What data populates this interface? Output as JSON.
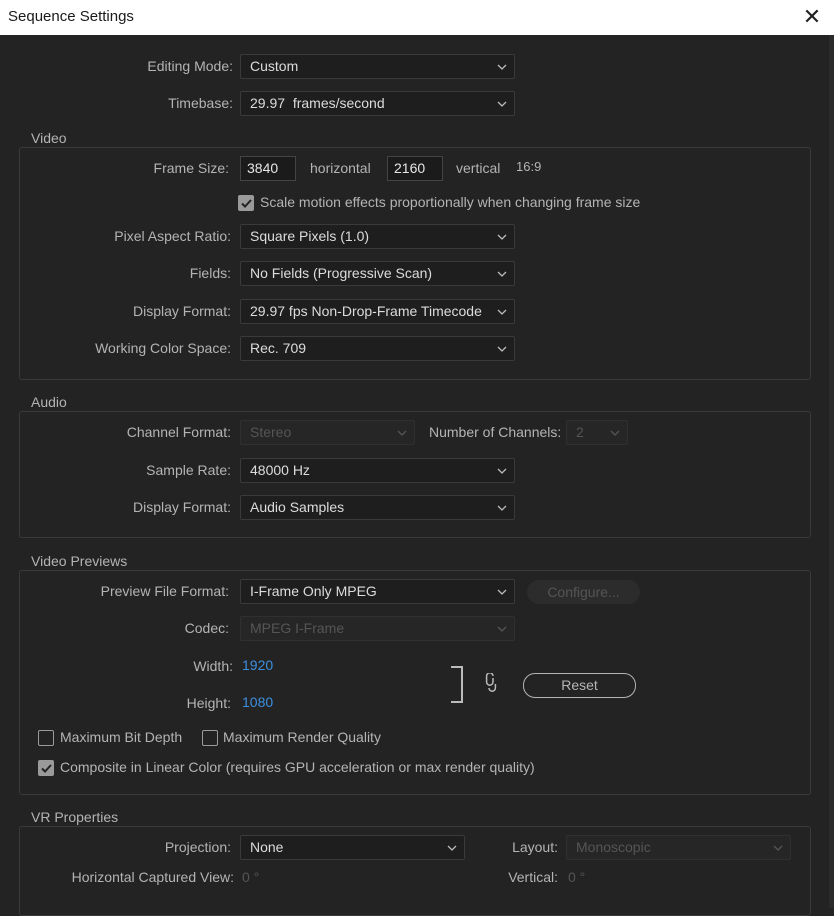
{
  "window": {
    "title": "Sequence Settings",
    "close_glyph": "✕"
  },
  "general": {
    "editing_mode_label": "Editing Mode:",
    "editing_mode_value": "Custom",
    "timebase_label": "Timebase:",
    "timebase_value": "29.97  frames/second"
  },
  "video": {
    "group_title": "Video",
    "frame_size_label": "Frame Size:",
    "frame_width": "3840",
    "horizontal_label": "horizontal",
    "frame_height": "2160",
    "vertical_label": "vertical",
    "aspect": "16:9",
    "scale_motion_label": "Scale motion effects proportionally when changing frame size",
    "scale_motion_checked": true,
    "pixel_aspect_label": "Pixel Aspect Ratio:",
    "pixel_aspect_value": "Square Pixels (1.0)",
    "fields_label": "Fields:",
    "fields_value": "No Fields (Progressive Scan)",
    "display_format_label": "Display Format:",
    "display_format_value": "29.97 fps Non-Drop-Frame Timecode",
    "color_space_label": "Working Color Space:",
    "color_space_value": "Rec. 709"
  },
  "audio": {
    "group_title": "Audio",
    "channel_format_label": "Channel Format:",
    "channel_format_value": "Stereo",
    "num_channels_label": "Number of Channels:",
    "num_channels_value": "2",
    "sample_rate_label": "Sample Rate:",
    "sample_rate_value": "48000 Hz",
    "display_format_label": "Display Format:",
    "display_format_value": "Audio Samples"
  },
  "previews": {
    "group_title": "Video Previews",
    "file_format_label": "Preview File Format:",
    "file_format_value": "I-Frame Only MPEG",
    "configure_label": "Configure...",
    "codec_label": "Codec:",
    "codec_value": "MPEG I-Frame",
    "width_label": "Width:",
    "width_value": "1920",
    "height_label": "Height:",
    "height_value": "1080",
    "reset_label": "Reset",
    "max_bit_depth_label": "Maximum Bit Depth",
    "max_bit_depth_checked": false,
    "max_render_quality_label": "Maximum Render Quality",
    "max_render_quality_checked": false,
    "linear_color_label": "Composite in Linear Color (requires GPU acceleration or max render quality)",
    "linear_color_checked": true
  },
  "vr": {
    "group_title": "VR Properties",
    "projection_label": "Projection:",
    "projection_value": "None",
    "layout_label": "Layout:",
    "layout_value": "Monoscopic",
    "h_captured_label": "Horizontal Captured View:",
    "h_captured_value": "0 °",
    "vertical_label": "Vertical:",
    "vertical_value": "0 °"
  },
  "colors": {
    "background": "#232323",
    "accent_blue": "#3d8fe0",
    "label_gray": "#b4b4b4"
  }
}
